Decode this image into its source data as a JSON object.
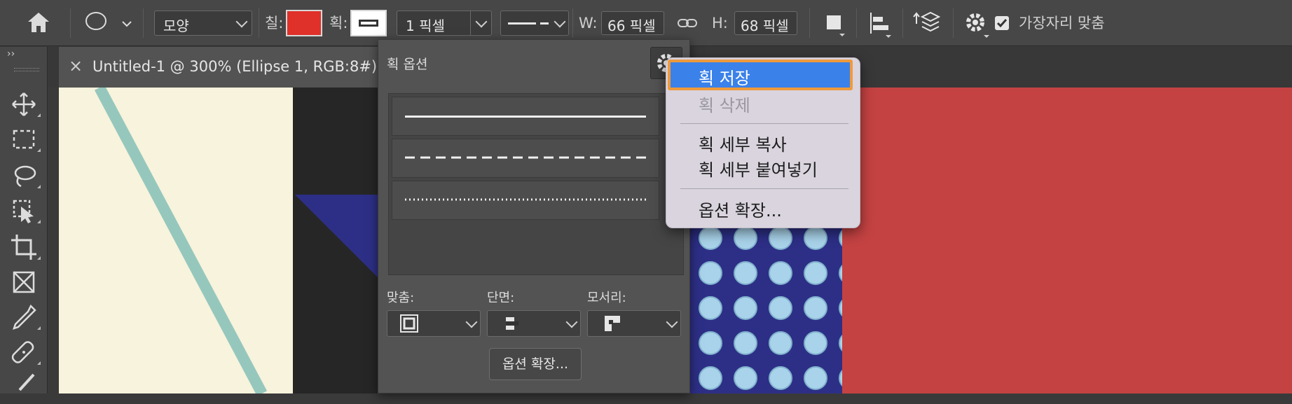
{
  "options_bar": {
    "shape_mode": "모양",
    "fill_label": "칠:",
    "fill_color": "#e0302a",
    "stroke_label": "획:",
    "stroke_width": "1 픽셀",
    "w_label": "W:",
    "w_value": "66 픽셀",
    "h_label": "H:",
    "h_value": "68 픽셀",
    "align_edges_label": "가장자리 맞춤",
    "align_edges_checked": true
  },
  "document_tab": {
    "close_glyph": "×",
    "title": "Untitled-1 @ 300% (Ellipse 1, RGB:8#)*"
  },
  "stroke_options_panel": {
    "title": "획 옵션",
    "styles": [
      "solid",
      "dashed",
      "dotted"
    ],
    "align_label": "맞춤:",
    "caps_label": "단면:",
    "corners_label": "모서리:",
    "more_options_button": "옵션 확장..."
  },
  "context_menu": {
    "items": [
      {
        "label": "획 저장",
        "state": "highlighted"
      },
      {
        "label": "획 삭제",
        "state": "disabled"
      },
      {
        "label": "획 세부 복사",
        "state": "normal"
      },
      {
        "label": "획 세부 붙여넣기",
        "state": "normal"
      },
      {
        "label": "옵션 확장...",
        "state": "normal"
      }
    ]
  },
  "colors": {
    "canvas_cream": "#f7f3dc",
    "canvas_red": "#c44242",
    "canvas_navy": "#2d2f86",
    "teal_stroke": "#96c7bd",
    "menu_highlight": "#3a81ea",
    "focus_ring": "#ee9a3c"
  }
}
